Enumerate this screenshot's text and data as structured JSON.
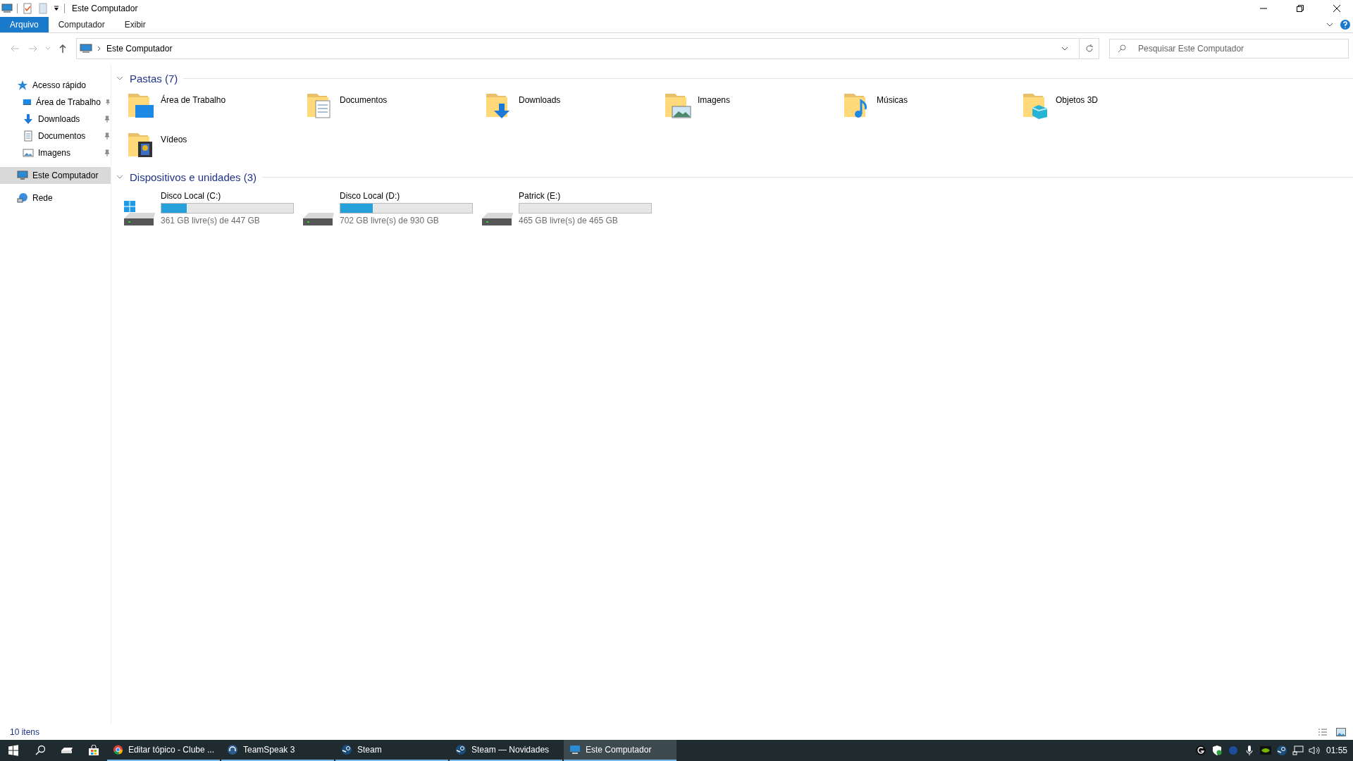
{
  "window": {
    "title": "Este Computador"
  },
  "ribbon_tabs": [
    {
      "label": "Arquivo",
      "selected": true
    },
    {
      "label": "Computador",
      "selected": false
    },
    {
      "label": "Exibir",
      "selected": false
    }
  ],
  "address": {
    "path": "Este Computador"
  },
  "search": {
    "placeholder": "Pesquisar Este Computador"
  },
  "sidebar": {
    "items": [
      {
        "label": "Acesso rápido",
        "kind": "star",
        "selected": false,
        "children": [
          {
            "label": "Área de Trabalho",
            "kind": "desktop",
            "pinned": true,
            "selected": false
          },
          {
            "label": "Downloads",
            "kind": "downloads",
            "pinned": true,
            "selected": false
          },
          {
            "label": "Documentos",
            "kind": "documents",
            "pinned": true,
            "selected": false
          },
          {
            "label": "Imagens",
            "kind": "pictures",
            "pinned": true,
            "selected": false
          }
        ]
      },
      {
        "label": "Este Computador",
        "kind": "computer",
        "selected": true
      },
      {
        "label": "Rede",
        "kind": "network",
        "selected": false
      }
    ]
  },
  "folders": {
    "heading": "Pastas (7)",
    "expanded": true,
    "items": [
      {
        "label": "Área de Trabalho",
        "kind": "desktop"
      },
      {
        "label": "Documentos",
        "kind": "documents"
      },
      {
        "label": "Downloads",
        "kind": "downloads"
      },
      {
        "label": "Imagens",
        "kind": "pictures"
      },
      {
        "label": "Músicas",
        "kind": "music"
      },
      {
        "label": "Objetos 3D",
        "kind": "objects3d"
      },
      {
        "label": "Vídeos",
        "kind": "videos"
      }
    ]
  },
  "drives": {
    "heading": "Dispositivos e unidades (3)",
    "expanded": true,
    "items": [
      {
        "label": "Disco Local (C:)",
        "system": true,
        "level": 0.19,
        "reading": "361 GB livre(s) de 447 GB"
      },
      {
        "label": "Disco Local (D:)",
        "system": false,
        "level": 0.245,
        "reading": "702 GB livre(s) de 930 GB"
      },
      {
        "label": "Patrick (E:)",
        "system": false,
        "level": 0.0,
        "reading": "465 GB livre(s) de 465 GB"
      }
    ]
  },
  "status_bar": {
    "count": "10 itens"
  },
  "taskbar": {
    "items": [
      {
        "label": "Editar tópico - Clube ...",
        "kind": "browser",
        "selected": false
      },
      {
        "label": "TeamSpeak 3",
        "kind": "headset",
        "selected": false
      },
      {
        "label": "Steam",
        "kind": "steam",
        "selected": false
      },
      {
        "label": "Steam — Novidades",
        "kind": "steam",
        "selected": false
      },
      {
        "label": "Este Computador",
        "kind": "computer",
        "selected": true
      }
    ],
    "time": "01:55"
  }
}
